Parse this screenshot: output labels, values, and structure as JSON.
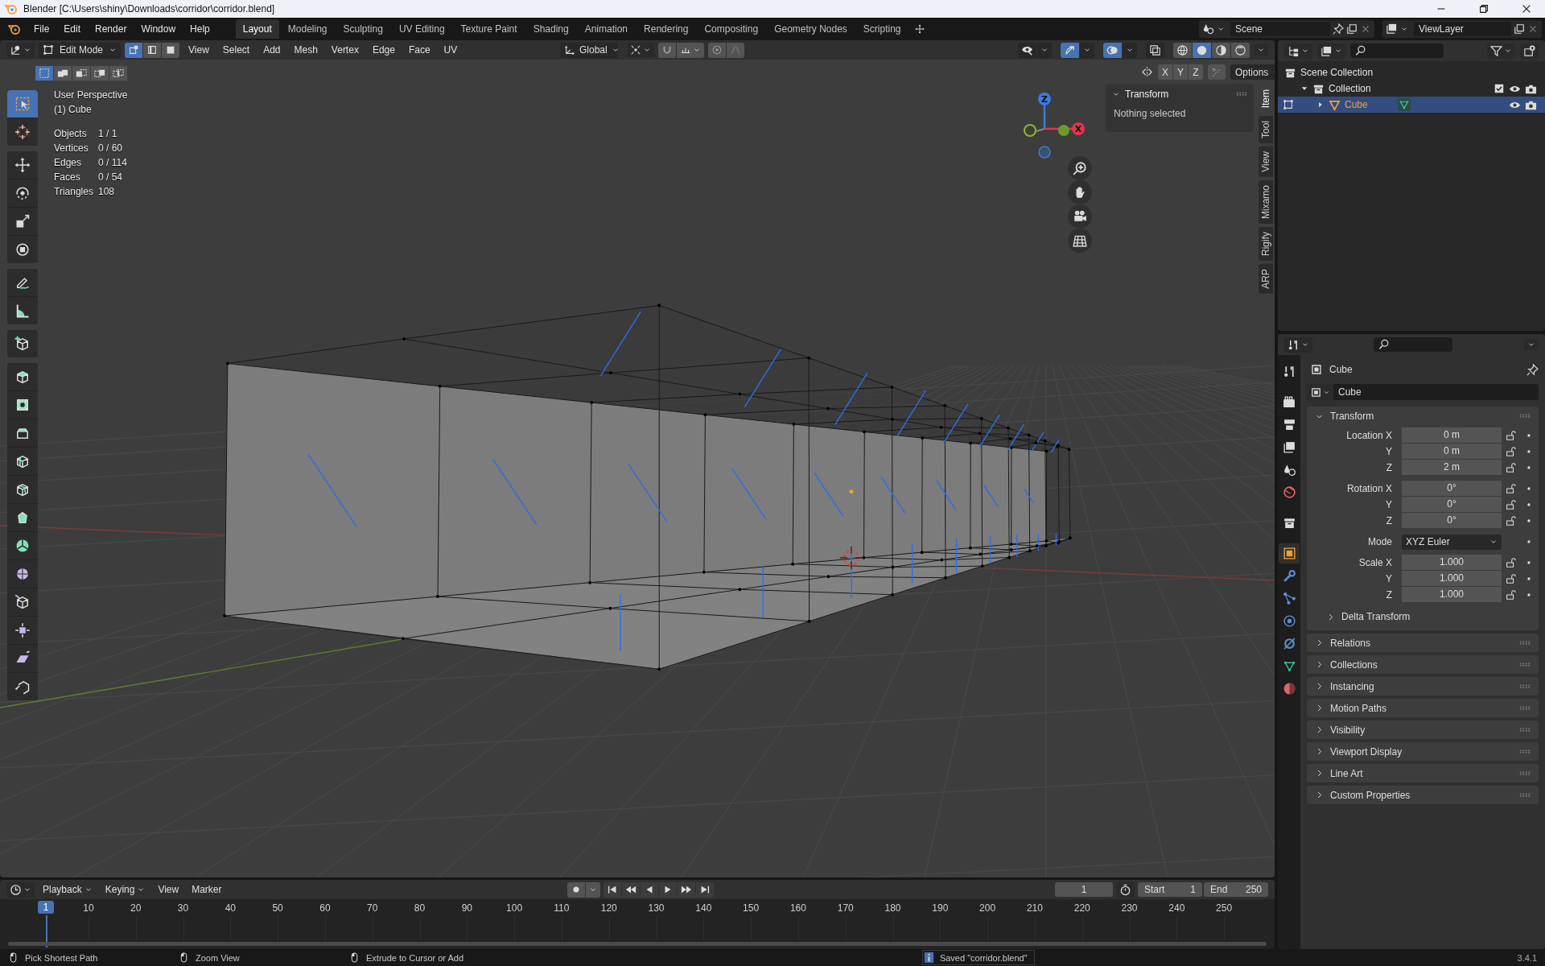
{
  "window": {
    "title": "Blender [C:\\Users\\shiny\\Downloads\\corridor\\corridor.blend]"
  },
  "menu": [
    "File",
    "Edit",
    "Render",
    "Window",
    "Help"
  ],
  "workspaces": [
    {
      "label": "Layout",
      "selected": true
    },
    {
      "label": "Modeling",
      "selected": false
    },
    {
      "label": "Sculpting",
      "selected": false
    },
    {
      "label": "UV Editing",
      "selected": false
    },
    {
      "label": "Texture Paint",
      "selected": false
    },
    {
      "label": "Shading",
      "selected": false
    },
    {
      "label": "Animation",
      "selected": false
    },
    {
      "label": "Rendering",
      "selected": false
    },
    {
      "label": "Compositing",
      "selected": false
    },
    {
      "label": "Geometry Nodes",
      "selected": false
    },
    {
      "label": "Scripting",
      "selected": false
    }
  ],
  "scene": "Scene",
  "view_layer": "ViewLayer",
  "viewport": {
    "mode": "Edit Mode",
    "select_modes": [
      {
        "kind": "vertex",
        "selected": true
      },
      {
        "kind": "edge",
        "selected": false
      },
      {
        "kind": "face",
        "selected": false
      }
    ],
    "menus": [
      "View",
      "Select",
      "Add",
      "Mesh",
      "Vertex",
      "Edge",
      "Face",
      "UV"
    ],
    "orientation": "Global",
    "toggles": [
      {
        "kind": "visibility",
        "on": false
      },
      {
        "kind": "gizmo",
        "on": true
      },
      {
        "kind": "overlay",
        "on": true
      },
      {
        "kind": "xray",
        "on": false
      }
    ],
    "shading": [
      {
        "kind": "wireframe",
        "selected": false
      },
      {
        "kind": "solid",
        "selected": true
      },
      {
        "kind": "material",
        "selected": false
      },
      {
        "kind": "rendered",
        "selected": false
      }
    ],
    "set_modes": [
      {
        "kind": "set",
        "selected": true
      },
      {
        "kind": "extend",
        "selected": false
      },
      {
        "kind": "subtract",
        "selected": false
      },
      {
        "kind": "invert",
        "selected": false
      },
      {
        "kind": "intersect",
        "selected": false
      }
    ],
    "mirror_axes": [
      {
        "label": "X",
        "on": false
      },
      {
        "label": "Y",
        "on": false
      },
      {
        "label": "Z",
        "on": false
      }
    ],
    "options": "Options",
    "info": {
      "view": "User Perspective",
      "object": "(1) Cube",
      "stats": [
        {
          "label": "Objects",
          "value": "1 / 1"
        },
        {
          "label": "Vertices",
          "value": "0 / 60"
        },
        {
          "label": "Edges",
          "value": "0 / 114"
        },
        {
          "label": "Faces",
          "value": "0 / 54"
        },
        {
          "label": "Triangles",
          "value": "108"
        }
      ]
    },
    "gizmo_labels": [
      "Z",
      "X"
    ],
    "tool_groups": [
      [
        {
          "kind": "select",
          "selected": true
        },
        {
          "kind": "cursor",
          "selected": false
        }
      ],
      [
        {
          "kind": "move",
          "selected": false
        },
        {
          "kind": "rotate",
          "selected": false
        },
        {
          "kind": "scale",
          "selected": false
        },
        {
          "kind": "transform",
          "selected": false
        }
      ],
      [
        {
          "kind": "annotate",
          "selected": false
        },
        {
          "kind": "measure",
          "selected": false
        }
      ],
      [
        {
          "kind": "add_cube",
          "selected": false
        }
      ],
      [
        {
          "kind": "extrude",
          "selected": false
        },
        {
          "kind": "inset",
          "selected": false
        },
        {
          "kind": "bevel",
          "selected": false
        },
        {
          "kind": "loop_cut",
          "selected": false
        },
        {
          "kind": "knife",
          "selected": false
        },
        {
          "kind": "poly_build",
          "selected": false
        },
        {
          "kind": "spin",
          "selected": false
        },
        {
          "kind": "smooth",
          "selected": false
        },
        {
          "kind": "edge_slide",
          "selected": false
        },
        {
          "kind": "shrink",
          "selected": false
        },
        {
          "kind": "shear",
          "selected": false
        },
        {
          "kind": "rip",
          "selected": false
        }
      ]
    ],
    "sidebar": {
      "title": "Transform",
      "message": "Nothing selected",
      "tabs": [
        {
          "label": "Item",
          "selected": true
        },
        {
          "label": "Tool",
          "selected": false
        },
        {
          "label": "View",
          "selected": false
        },
        {
          "label": "Mixamo",
          "selected": false
        },
        {
          "label": "Rigify",
          "selected": false
        },
        {
          "label": "ARP",
          "selected": false
        }
      ]
    }
  },
  "outliner": {
    "tree": [
      {
        "label": "Scene Collection",
        "kind": "scene",
        "selected": false,
        "children": [
          {
            "label": "Collection",
            "kind": "collection",
            "expanded": true,
            "checked": true,
            "selected": false,
            "children": [
              {
                "label": "Cube",
                "kind": "mesh_object",
                "expanded": false,
                "selected": true
              }
            ]
          }
        ]
      }
    ]
  },
  "properties": {
    "tabs": [
      {
        "kind": "tool",
        "selected": false
      },
      {
        "kind": "render",
        "selected": false
      },
      {
        "kind": "output",
        "selected": false
      },
      {
        "kind": "view_layer",
        "selected": false
      },
      {
        "kind": "scene",
        "selected": false
      },
      {
        "kind": "world",
        "selected": false
      },
      {
        "kind": "collection",
        "selected": false
      },
      {
        "kind": "object",
        "selected": true
      },
      {
        "kind": "modifier",
        "selected": false
      },
      {
        "kind": "particles",
        "selected": false
      },
      {
        "kind": "physics",
        "selected": false
      },
      {
        "kind": "constraint",
        "selected": false
      },
      {
        "kind": "data",
        "selected": false
      },
      {
        "kind": "material",
        "selected": false
      }
    ],
    "object": "Cube",
    "datablock": "Cube",
    "transform": {
      "title": "Transform",
      "expanded": true,
      "groups": [
        [
          {
            "label": "Location X",
            "value": "0 m",
            "kind": "number"
          },
          {
            "label": "Y",
            "value": "0 m",
            "kind": "number"
          },
          {
            "label": "Z",
            "value": "2 m",
            "kind": "number"
          }
        ],
        [
          {
            "label": "Rotation X",
            "value": "0°",
            "kind": "number"
          },
          {
            "label": "Y",
            "value": "0°",
            "kind": "number"
          },
          {
            "label": "Z",
            "value": "0°",
            "kind": "number"
          }
        ],
        [
          {
            "label": "Mode",
            "value": "XYZ Euler",
            "kind": "dropdown"
          }
        ],
        [
          {
            "label": "Scale X",
            "value": "1.000",
            "kind": "number"
          },
          {
            "label": "Y",
            "value": "1.000",
            "kind": "number"
          },
          {
            "label": "Z",
            "value": "1.000",
            "kind": "number"
          }
        ]
      ],
      "subpanel": "Delta Transform"
    },
    "panels": [
      "Relations",
      "Collections",
      "Instancing",
      "Motion Paths",
      "Visibility",
      "Viewport Display",
      "Line Art",
      "Custom Properties"
    ]
  },
  "timeline": {
    "menus": [
      {
        "label": "Playback",
        "dropdown": true
      },
      {
        "label": "Keying",
        "dropdown": true
      },
      {
        "label": "View",
        "dropdown": false
      },
      {
        "label": "Marker",
        "dropdown": false
      }
    ],
    "current_frame": "1",
    "start_label": "Start",
    "start": "1",
    "end_label": "End",
    "end": "250",
    "playhead": "1",
    "ruler": [
      "10",
      "20",
      "30",
      "40",
      "50",
      "60",
      "70",
      "80",
      "90",
      "100",
      "110",
      "120",
      "130",
      "140",
      "150",
      "160",
      "170",
      "180",
      "190",
      "200",
      "210",
      "220",
      "230",
      "240",
      "250"
    ]
  },
  "status": {
    "hints": [
      "Pick Shortest Path",
      "Zoom View",
      "Extrude to Cursor or Add"
    ],
    "message": "Saved \"corridor.blend\"",
    "version": "3.4.1"
  }
}
